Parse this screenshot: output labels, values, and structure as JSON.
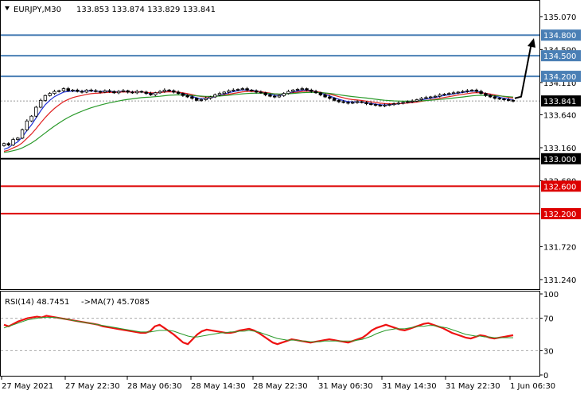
{
  "header": {
    "symbol_timeframe": "EURJPY,M30",
    "ohlc": "133.853 133.874 133.829 133.841"
  },
  "rsi_header": {
    "label": "RSI(14) 48.7451",
    "ma_label": "->MA(7) 45.7085"
  },
  "colors": {
    "resistance": "#4a7fb5",
    "support": "#dd0000",
    "pivot": "#000000",
    "ma_fast": "#1f2fd6",
    "ma_mid": "#e02020",
    "ma_slow": "#2a9a2a",
    "rsi_line": "#ee1111",
    "rsi_ma": "#2a9a2a",
    "price_tag": "#000000"
  },
  "chart_data": {
    "type": "candlestick",
    "price_axis": {
      "ylim": [
        131.1,
        135.3
      ],
      "tick_labels": [
        "135.070",
        "134.590",
        "134.110",
        "133.640",
        "133.160",
        "132.680",
        "131.720",
        "131.240"
      ]
    },
    "x_axis": {
      "tick_labels": [
        "27 May 2021",
        "27 May 22:30",
        "28 May 06:30",
        "28 May 14:30",
        "28 May 22:30",
        "31 May 06:30",
        "31 May 14:30",
        "31 May 22:30",
        "1 Jun 06:30"
      ]
    },
    "current_price": "133.841",
    "current_price_value": 133.841,
    "levels": [
      {
        "label": "134.800",
        "value": 134.8,
        "kind": "resistance"
      },
      {
        "label": "134.500",
        "value": 134.5,
        "kind": "resistance"
      },
      {
        "label": "134.200",
        "value": 134.2,
        "kind": "resistance"
      },
      {
        "label": "133.000",
        "value": 133.0,
        "kind": "pivot"
      },
      {
        "label": "132.600",
        "value": 132.6,
        "kind": "support"
      },
      {
        "label": "132.200",
        "value": 132.2,
        "kind": "support"
      }
    ],
    "close_path": [
      133.22,
      133.2,
      133.28,
      133.3,
      133.42,
      133.55,
      133.62,
      133.75,
      133.85,
      133.92,
      133.95,
      133.98,
      133.99,
      134.02,
      133.99,
      134.0,
      133.98,
      133.97,
      134.0,
      133.99,
      133.98,
      133.97,
      133.99,
      133.98,
      133.96,
      133.98,
      133.99,
      133.97,
      133.96,
      133.98,
      133.97,
      133.95,
      133.93,
      133.96,
      133.98,
      134.0,
      133.99,
      133.97,
      133.95,
      133.92,
      133.9,
      133.88,
      133.85,
      133.86,
      133.88,
      133.9,
      133.93,
      133.95,
      133.97,
      133.99,
      134.0,
      134.01,
      134.02,
      134.0,
      133.99,
      133.97,
      133.96,
      133.93,
      133.91,
      133.9,
      133.92,
      133.95,
      133.98,
      134.0,
      134.01,
      134.02,
      134.0,
      133.98,
      133.96,
      133.93,
      133.9,
      133.88,
      133.85,
      133.83,
      133.82,
      133.81,
      133.82,
      133.83,
      133.82,
      133.8,
      133.79,
      133.78,
      133.77,
      133.78,
      133.79,
      133.8,
      133.81,
      133.82,
      133.83,
      133.84,
      133.86,
      133.88,
      133.89,
      133.9,
      133.91,
      133.93,
      133.94,
      133.95,
      133.96,
      133.97,
      133.98,
      133.99,
      134.0,
      133.98,
      133.95,
      133.92,
      133.9,
      133.88,
      133.87,
      133.86,
      133.85,
      133.84
    ],
    "forecast_path": [
      133.88,
      134.78
    ],
    "indicators": [
      {
        "name": "ma_fast",
        "period": "fast"
      },
      {
        "name": "ma_mid",
        "period": "medium"
      },
      {
        "name": "ma_slow",
        "period": "slow"
      }
    ],
    "rsi": {
      "ylim": [
        0,
        100
      ],
      "tick_labels": [
        "100",
        "70",
        "30",
        "0"
      ],
      "levels": [
        70,
        30
      ],
      "values": [
        62,
        60,
        63,
        66,
        68,
        70,
        71,
        72,
        71,
        73,
        72,
        71,
        70,
        69,
        68,
        67,
        66,
        65,
        64,
        63,
        62,
        60,
        59,
        58,
        57,
        56,
        55,
        54,
        53,
        52,
        52,
        54,
        60,
        62,
        58,
        54,
        50,
        45,
        40,
        38,
        44,
        50,
        54,
        56,
        55,
        54,
        53,
        52,
        52,
        53,
        55,
        56,
        57,
        55,
        52,
        48,
        44,
        40,
        38,
        40,
        42,
        44,
        43,
        42,
        41,
        40,
        41,
        42,
        43,
        44,
        43,
        42,
        41,
        40,
        42,
        44,
        46,
        50,
        55,
        58,
        60,
        62,
        60,
        58,
        56,
        55,
        57,
        59,
        61,
        63,
        64,
        62,
        60,
        58,
        55,
        52,
        50,
        48,
        46,
        45,
        47,
        49,
        48,
        46,
        45,
        46,
        47,
        48,
        49
      ],
      "ma_values": [
        58,
        60,
        62,
        64,
        66,
        68,
        69,
        70,
        71,
        71,
        71,
        71,
        70,
        69,
        68,
        67,
        66,
        65,
        64,
        63,
        62,
        61,
        60,
        59,
        58,
        57,
        56,
        55,
        54,
        53,
        53,
        53,
        54,
        55,
        55,
        55,
        54,
        52,
        50,
        48,
        47,
        47,
        48,
        49,
        50,
        51,
        52,
        52,
        53,
        53,
        54,
        54,
        55,
        54,
        53,
        51,
        49,
        47,
        45,
        44,
        43,
        43,
        43,
        42,
        42,
        41,
        41,
        41,
        42,
        42,
        42,
        42,
        42,
        42,
        42,
        43,
        44,
        46,
        48,
        51,
        53,
        55,
        56,
        57,
        57,
        57,
        58,
        59,
        60,
        60,
        61,
        61,
        60,
        59,
        58,
        56,
        54,
        52,
        50,
        49,
        48,
        48,
        47,
        47,
        46,
        46,
        46,
        46,
        46
      ]
    }
  }
}
